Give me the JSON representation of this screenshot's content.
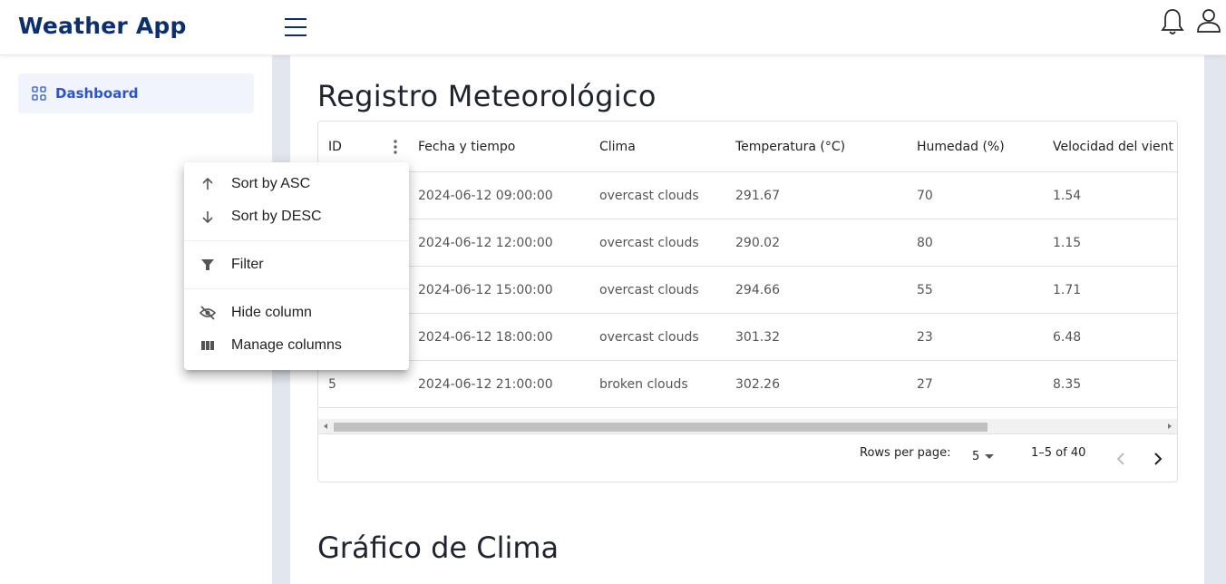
{
  "app": {
    "title": "Weather App"
  },
  "sidebar": {
    "items": [
      {
        "label": "Dashboard",
        "icon": "dashboard-grid-icon"
      }
    ]
  },
  "header": {
    "icons": [
      "menu-icon",
      "bell-icon",
      "user-icon"
    ]
  },
  "main": {
    "title": "Registro Meteorológico",
    "table": {
      "columns": [
        "ID",
        "Fecha y tiempo",
        "Clima",
        "Temperatura (°C)",
        "Humedad (%)",
        "Velocidad del vient"
      ],
      "rows": [
        [
          "",
          "2024-06-12 09:00:00",
          "overcast clouds",
          "291.67",
          "70",
          "1.54"
        ],
        [
          "",
          "2024-06-12 12:00:00",
          "overcast clouds",
          "290.02",
          "80",
          "1.15"
        ],
        [
          "",
          "2024-06-12 15:00:00",
          "overcast clouds",
          "294.66",
          "55",
          "1.71"
        ],
        [
          "",
          "2024-06-12 18:00:00",
          "overcast clouds",
          "301.32",
          "23",
          "6.48"
        ],
        [
          "5",
          "2024-06-12 21:00:00",
          "broken clouds",
          "302.26",
          "27",
          "8.35"
        ]
      ]
    },
    "pagination": {
      "rows_per_page_label": "Rows per page:",
      "rows_per_page_value": "5",
      "range": "1–5 of 40"
    },
    "chart_section": {
      "title": "Gráfico de Clima"
    }
  },
  "column_menu": {
    "items": [
      {
        "label": "Sort by ASC",
        "icon": "arrow-up-icon"
      },
      {
        "label": "Sort by DESC",
        "icon": "arrow-down-icon"
      },
      {
        "label": "Filter",
        "icon": "filter-icon"
      },
      {
        "label": "Hide column",
        "icon": "eye-off-icon"
      },
      {
        "label": "Manage columns",
        "icon": "columns-icon"
      }
    ]
  },
  "colors": {
    "brand": "#0d2f6e",
    "accent": "#2d55c7",
    "nav_bg": "#f1f4fb"
  }
}
